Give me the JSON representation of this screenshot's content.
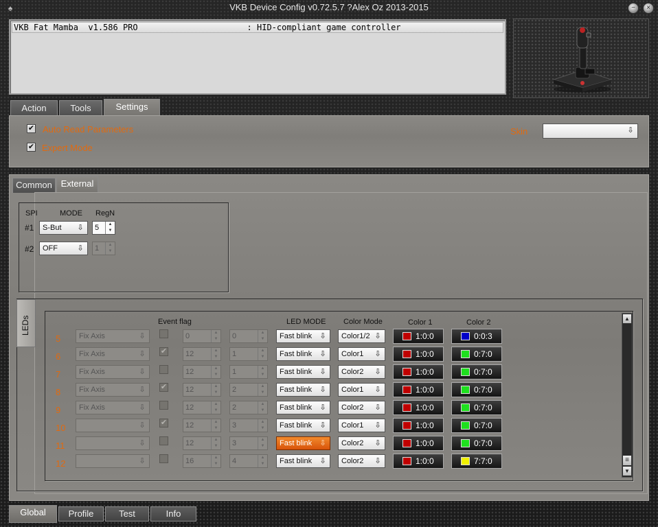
{
  "window": {
    "title": "VKB Device Config v0.72.5.7 ?Alex Oz 2013-2015",
    "minimize_glyph": "−",
    "close_glyph": "×"
  },
  "device_list": {
    "rows": [
      "VKB Fat Mamba  v1.586 PRO                      : HID-compliant game controller"
    ]
  },
  "main_tabs": [
    {
      "label": "Action"
    },
    {
      "label": "Tools"
    },
    {
      "label": "Settings"
    }
  ],
  "settings": {
    "auto_read_label": "Auto Read Parameters",
    "expert_mode_label": "Expert Mode",
    "auto_read_checked": true,
    "expert_mode_checked": true,
    "skin_label": "Skin",
    "skin_value": ""
  },
  "sub_tabs": [
    {
      "label": "Common"
    },
    {
      "label": "External"
    }
  ],
  "spi": {
    "headers": {
      "spi": "SPI",
      "mode": "MODE",
      "regn": "RegN"
    },
    "rows": [
      {
        "label": "#1",
        "mode": "S-But",
        "regn": "5"
      },
      {
        "label": "#2",
        "mode": "OFF",
        "regn": "1"
      }
    ]
  },
  "leds": {
    "side_tab": "LEDs",
    "headers": {
      "event_flag": "Event flag",
      "led_mode": "LED MODE",
      "color_mode": "Color Mode",
      "color1": "Color 1",
      "color2": "Color 2"
    },
    "rows": [
      {
        "num": "5",
        "axis": "Fix Axis",
        "flag": false,
        "v1": "0",
        "v2": "0",
        "mode": "Fast blink",
        "cmode": "Color1/2",
        "c1": "1:0:0",
        "c1_color": "#c00000",
        "c2": "0:0:3",
        "c2_color": "#0000c8"
      },
      {
        "num": "6",
        "axis": "Fix Axis",
        "flag": true,
        "v1": "12",
        "v2": "1",
        "mode": "Fast blink",
        "cmode": "Color1",
        "c1": "1:0:0",
        "c1_color": "#c00000",
        "c2": "0:7:0",
        "c2_color": "#1ee01e"
      },
      {
        "num": "7",
        "axis": "Fix Axis",
        "flag": false,
        "v1": "12",
        "v2": "1",
        "mode": "Fast blink",
        "cmode": "Color2",
        "c1": "1:0:0",
        "c1_color": "#c00000",
        "c2": "0:7:0",
        "c2_color": "#1ee01e"
      },
      {
        "num": "8",
        "axis": "Fix Axis",
        "flag": true,
        "v1": "12",
        "v2": "2",
        "mode": "Fast blink",
        "cmode": "Color1",
        "c1": "1:0:0",
        "c1_color": "#c00000",
        "c2": "0:7:0",
        "c2_color": "#1ee01e"
      },
      {
        "num": "9",
        "axis": "Fix Axis",
        "flag": false,
        "v1": "12",
        "v2": "2",
        "mode": "Fast blink",
        "cmode": "Color2",
        "c1": "1:0:0",
        "c1_color": "#c00000",
        "c2": "0:7:0",
        "c2_color": "#1ee01e"
      },
      {
        "num": "10",
        "axis": "",
        "flag": true,
        "v1": "12",
        "v2": "3",
        "mode": "Fast blink",
        "cmode": "Color1",
        "c1": "1:0:0",
        "c1_color": "#c00000",
        "c2": "0:7:0",
        "c2_color": "#1ee01e"
      },
      {
        "num": "11",
        "axis": "",
        "flag": false,
        "v1": "12",
        "v2": "3",
        "mode": "Fast blink",
        "cmode": "Color2",
        "c1": "1:0:0",
        "c1_color": "#c00000",
        "c2": "0:7:0",
        "c2_color": "#1ee01e"
      },
      {
        "num": "12",
        "axis": "",
        "flag": false,
        "v1": "16",
        "v2": "4",
        "mode": "Fast blink",
        "cmode": "Color2",
        "c1": "1:0:0",
        "c1_color": "#c00000",
        "c2": "7:7:0",
        "c2_color": "#f0f000"
      }
    ]
  },
  "bottom_tabs": [
    {
      "label": "Global"
    },
    {
      "label": "Profile"
    },
    {
      "label": "Test"
    },
    {
      "label": "Info"
    }
  ],
  "icons": {
    "app": "joystick-icon",
    "dropdown_arrow": "⇩",
    "check": "✔",
    "scroll_up": "▲",
    "scroll_down": "▼",
    "scroll_grip": "≡"
  }
}
